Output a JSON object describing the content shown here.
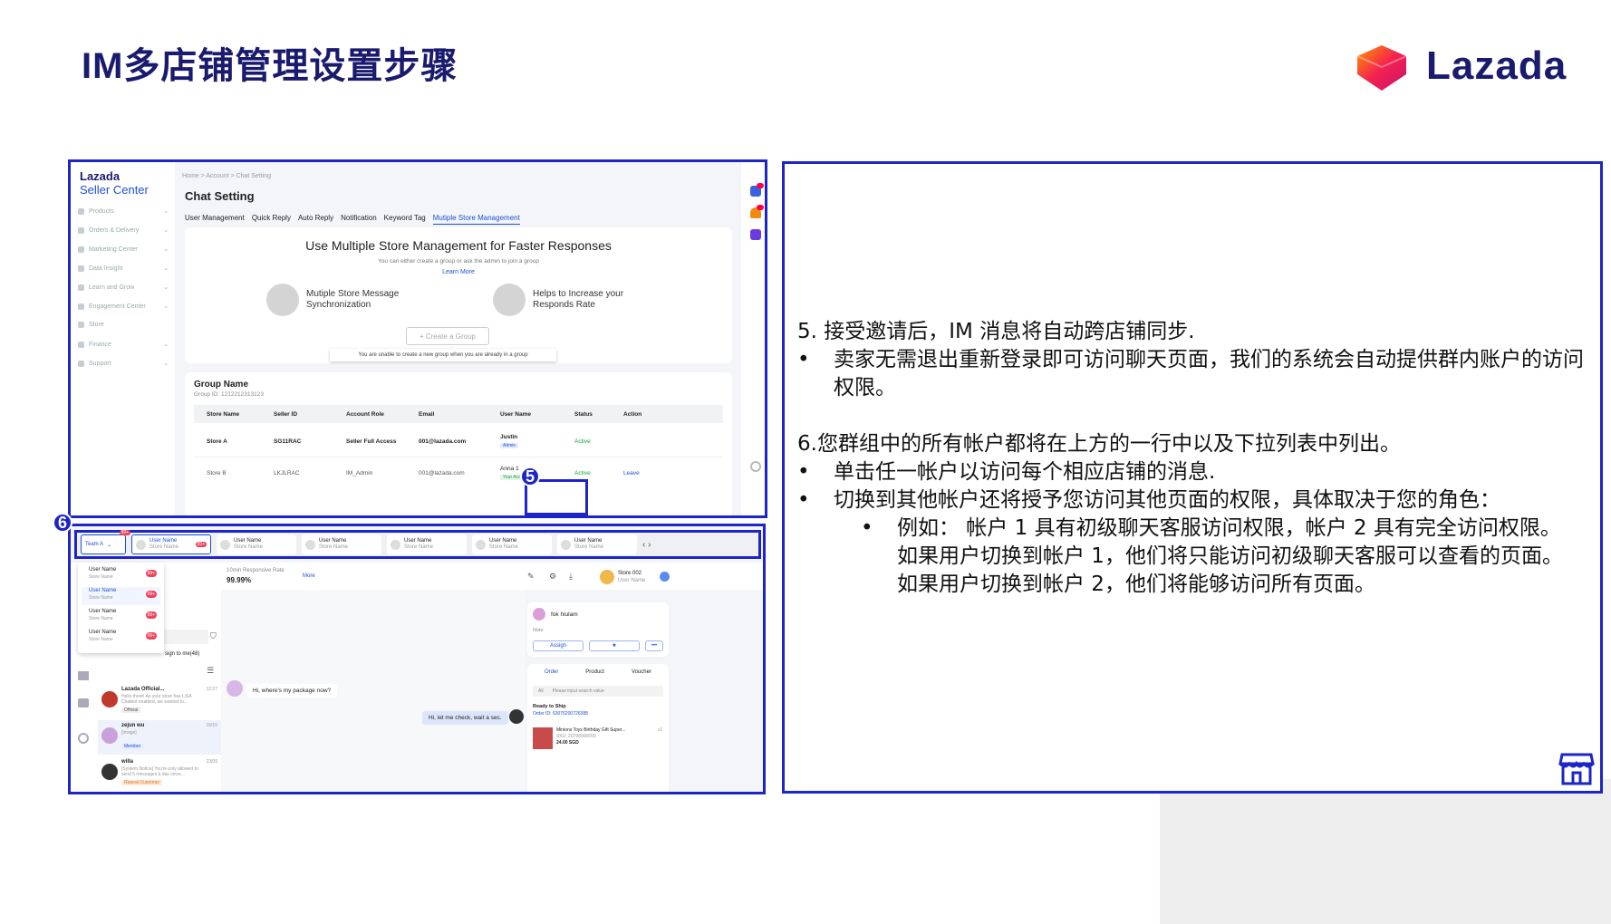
{
  "slide": {
    "title": "IM多店铺管理设置步骤",
    "brand": "Lazada"
  },
  "colors": {
    "accent": "#1d24c8",
    "brand_blue": "#1a1a6e",
    "link": "#1d4fd8",
    "active_green": "#1aa34a"
  },
  "seller_center": {
    "brand_line1": "Lazada",
    "brand_line2": "Seller Center",
    "sidebar": [
      "Products",
      "Orders & Delivery",
      "Marketing Center",
      "Data Insight",
      "Learn and Grow",
      "Engagement Center",
      "Store",
      "Finance",
      "Support"
    ],
    "breadcrumb": "Home > Account > Chat Setting",
    "page_title": "Chat Setting",
    "tabs": [
      "User Management",
      "Quick Reply",
      "Auto Reply",
      "Notification",
      "Keyword Tag",
      "Mutiple Store Management"
    ],
    "promo": {
      "heading": "Use Multiple Store Management for Faster Responses",
      "sub": "You can either create a group or ask the admin to join a group",
      "learn_more": "Learn More",
      "feature1": "Mutiple Store Message Synchronization",
      "feature2": "Helps to Increase your Responds Rate",
      "create_btn": "+ Create a Group",
      "note": "You are unable to create a new group when you are already in a group"
    },
    "group": {
      "name": "Group Name",
      "id": "Group ID: 1212212313123",
      "headers": [
        "Store Name",
        "Seller ID",
        "Account Role",
        "Email",
        "User Name",
        "Status",
        "Action"
      ],
      "rows": [
        {
          "store": "Store A",
          "seller": "SG11RAC",
          "role": "Seller Full Access",
          "email": "001@lazada.com",
          "user": "Justin",
          "tag": "Admin",
          "status": "Active",
          "action": ""
        },
        {
          "store": "Store B",
          "seller": "LKJLRAC",
          "role": "IM_Admin",
          "email": "001@lazada.com",
          "user": "Anna 1",
          "tag": "Your Account",
          "status": "Active",
          "action": "Leave"
        }
      ]
    }
  },
  "callouts": {
    "c5": "5",
    "c6": "6"
  },
  "chat": {
    "team": "Team A",
    "team_badge": "99+",
    "store_tabs": [
      {
        "user": "User Name",
        "store": "Store Name",
        "badge": "99+"
      },
      {
        "user": "User Name",
        "store": "Store Name",
        "badge": ""
      },
      {
        "user": "User Name",
        "store": "Store Name",
        "badge": ""
      },
      {
        "user": "User Name",
        "store": "Store Name",
        "badge": ""
      },
      {
        "user": "User Name",
        "store": "Store Name",
        "badge": ""
      },
      {
        "user": "User Name",
        "store": "Store Name",
        "badge": ""
      }
    ],
    "dropdown": [
      {
        "user": "User Name",
        "store": "Store Name",
        "badge": "99+"
      },
      {
        "user": "User Name",
        "store": "Store Name",
        "badge": "99+"
      },
      {
        "user": "User Name",
        "store": "Store Name",
        "badge": "99+"
      },
      {
        "user": "User Name",
        "store": "Store Name",
        "badge": "99+"
      }
    ],
    "assign": "sign to me(48)",
    "rate_label": "10min Responsive Rate",
    "rate_value": "99.99%",
    "more": "More",
    "store_header": {
      "store": "Store 002",
      "user": "User Name"
    },
    "conversations": [
      {
        "name": "Lazada Official...",
        "time": "12:27",
        "preview": "Hello there! As your store has LiSA Chatbot enabled, we wanted to...",
        "tag": "Official"
      },
      {
        "name": "zejun wu",
        "time": "15/15",
        "preview": "[Image]",
        "tag": "Member"
      },
      {
        "name": "willa",
        "time": "23/09",
        "preview": "[System Notice] You're only allowed to send 5 messages a day since...",
        "tag": "Repeat Customer"
      }
    ],
    "msg_in": "Hi, where's my package now?",
    "msg_out": "Hi, let me check, wait a sec.",
    "customer": {
      "name": "fok hiulam",
      "note": "Note",
      "assign": "Assign",
      "rating": "★"
    },
    "order_tabs": [
      "Order",
      "Product",
      "Voucher"
    ],
    "order_filter": "All",
    "order_search": "Please input search value",
    "order": {
      "status": "Ready to Ship",
      "id": "Order ID: 63076200726388",
      "item": "Minions Toys Birthday Gift Super...",
      "sku": "SKU: 20798000559",
      "qty": "x1",
      "price": "24.00 SGD"
    }
  },
  "instructions": {
    "p5": "5. 接受邀请后，IM 消息将自动跨店铺同步.",
    "p5_b1": "卖家无需退出重新登录即可访问聊天页面，我们的系统会自动提供群内账户的访问权限。",
    "p6": "6.您群组中的所有帐户都将在上方的一行中以及下拉列表中列出。",
    "p6_b1": "单击任一帐户以访问每个相应店铺的消息.",
    "p6_b2": "切换到其他帐户还将授予您访问其他页面的权限，具体取决于您的角色：",
    "p6_b2_sub": "例如： 帐户 1 具有初级聊天客服访问权限，帐户 2 具有完全访问权限。 如果用户切换到帐户 1，他们将只能访问初级聊天客服可以查看的页面。 如果用户切换到帐户 2，他们将能够访问所有页面。"
  }
}
